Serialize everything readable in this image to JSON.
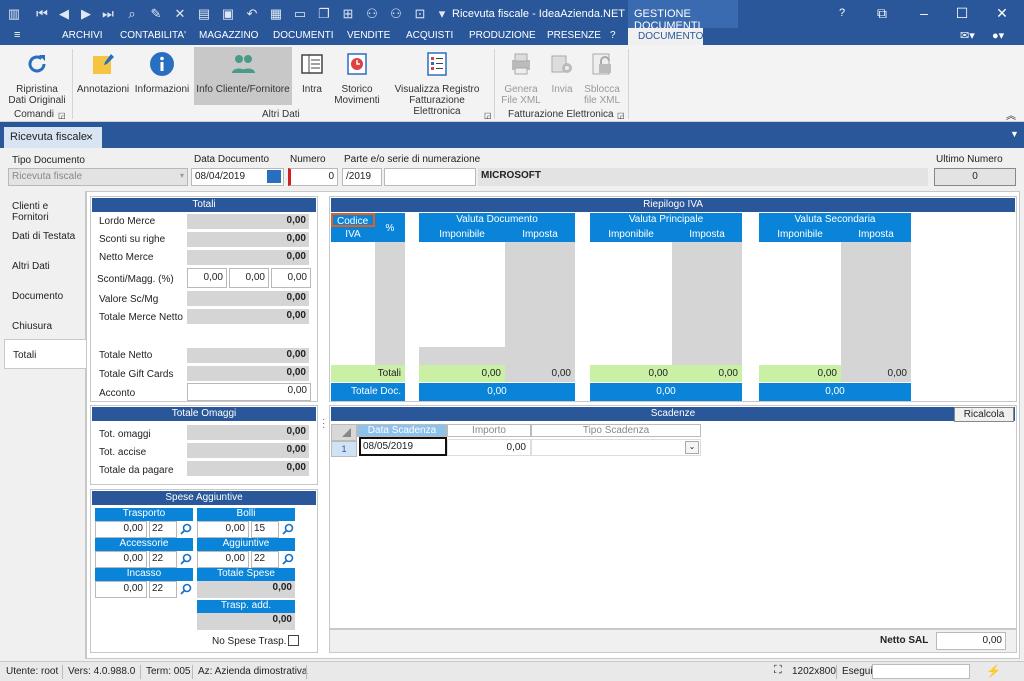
{
  "titlebar": {
    "title": "Ricevuta fiscale - IdeaAzienda.NET - Sm...",
    "context_tab": "GESTIONE DOCUMENTI",
    "help": "?",
    "colors": {
      "bar": "#2a579a",
      "accent": "#0a84d8"
    }
  },
  "menu": {
    "app_icon": "≡",
    "items": [
      "ARCHIVI",
      "CONTABILITA'",
      "MAGAZZINO",
      "DOCUMENTI",
      "VENDITE",
      "ACQUISTI",
      "PRODUZIONE",
      "PRESENZE",
      "?"
    ],
    "active": "DOCUMENTO"
  },
  "ribbon": {
    "buttons": {
      "ripristina": "Ripristina\nDati Originali",
      "annotazioni": "Annotazioni",
      "informazioni": "Informazioni",
      "info_cliente": "Info Cliente/Fornitore",
      "intra": "Intra",
      "storico": "Storico\nMovimenti",
      "visualizza": "Visualizza Registro\nFatturazione Elettronica",
      "genera": "Genera\nFile XML",
      "invia": "Invia",
      "sblocca": "Sblocca\nfile XML"
    },
    "groups": {
      "comandi": "Comandi",
      "altri_dati": "Altri Dati",
      "fatt_elettronica": "Fatturazione Elettronica"
    }
  },
  "doc_tab": {
    "label": "Ricevuta fiscale",
    "close": "×"
  },
  "header": {
    "tipo_documento_label": "Tipo Documento",
    "tipo_documento_value": "Ricevuta fiscale",
    "data_documento_label": "Data Documento",
    "data_documento_value": "08/04/2019",
    "numero_label": "Numero",
    "numero_value": "0",
    "parte_label": "Parte e/o serie di numerazione",
    "parte_value": "/2019",
    "serie_name": "MICROSOFT",
    "ultimo_numero_label": "Ultimo Numero",
    "ultimo_numero_value": "0"
  },
  "leftnav": {
    "items": [
      "Clienti e Fornitori",
      "Dati di Testata",
      "Altri Dati",
      "Documento",
      "Chiusura",
      "Totali"
    ],
    "active_index": 5
  },
  "totali": {
    "title": "Totali",
    "lordo_merce": {
      "label": "Lordo Merce",
      "value": "0,00"
    },
    "sconti_righe": {
      "label": "Sconti su righe",
      "value": "0,00"
    },
    "netto_merce": {
      "label": "Netto Merce",
      "value": "0,00"
    },
    "sconti_magg": {
      "label": "Sconti/Magg. (%)",
      "values": [
        "0,00",
        "0,00",
        "0,00"
      ]
    },
    "valore_sc": {
      "label": "Valore Sc/Mg",
      "value": "0,00"
    },
    "totale_merce_netto": {
      "label": "Totale Merce Netto",
      "value": "0,00"
    },
    "totale_netto": {
      "label": "Totale Netto",
      "value": "0,00"
    },
    "totale_gift": {
      "label": "Totale Gift Cards",
      "value": "0,00"
    },
    "acconto": {
      "label": "Acconto",
      "value": "0,00"
    }
  },
  "omaggi": {
    "title": "Totale Omaggi",
    "tot_omaggi": {
      "label": "Tot. omaggi",
      "value": "0,00"
    },
    "tot_accise": {
      "label": "Tot. accise",
      "value": "0,00"
    },
    "totale_pagare": {
      "label": "Totale da pagare",
      "value": "0,00"
    }
  },
  "spese": {
    "title": "Spese Aggiuntive",
    "trasporto": {
      "label": "Trasporto",
      "value": "0,00",
      "iva": "22"
    },
    "bolli": {
      "label": "Bolli",
      "value": "0,00",
      "iva": "15"
    },
    "accessorie": {
      "label": "Accessorie",
      "value": "0,00",
      "iva": "22"
    },
    "aggiuntive": {
      "label": "Aggiuntive",
      "value": "0,00",
      "iva": "22"
    },
    "incasso": {
      "label": "Incasso",
      "value": "0,00",
      "iva": "22"
    },
    "totale_spese": {
      "label": "Totale Spese",
      "value": "0,00"
    },
    "trasp_add": {
      "label": "Trasp. add.",
      "value": "0,00"
    },
    "no_spese": "No Spese Trasp."
  },
  "riepilogo": {
    "title": "Riepilogo IVA",
    "codice": "Codice",
    "iva": "IVA",
    "perc": "%",
    "valuta_documento": "Valuta Documento",
    "valuta_principale": "Valuta Principale",
    "valuta_secondaria": "Valuta Secondaria",
    "imponibile": "Imponibile",
    "imposta": "Imposta",
    "totali_label": "Totali",
    "totale_doc_label": "Totale Doc.",
    "totali": {
      "doc_imp": "0,00",
      "doc_imposta": "0,00",
      "pri_imp": "0,00",
      "pri_imposta": "0,00",
      "sec_imp": "0,00",
      "sec_imposta": "0,00"
    },
    "totale_doc": {
      "doc": "0,00",
      "pri": "0,00",
      "sec": "0,00"
    }
  },
  "scadenze": {
    "title": "Scadenze",
    "ricalcola": "Ricalcola",
    "cols": [
      "Data Scadenza",
      "Importo",
      "Tipo Scadenza"
    ],
    "row": {
      "n": "1",
      "data": "08/05/2019",
      "importo": "0,00",
      "tipo": ""
    }
  },
  "netto_sal": {
    "label": "Netto SAL",
    "value": "0,00"
  },
  "status": {
    "utente": "Utente: root",
    "vers": "Vers: 4.0.988.0",
    "term": "Term: 005",
    "az": "Az: Azienda dimostrativa",
    "resolution": "1202x800",
    "esegui": "Esegui"
  }
}
